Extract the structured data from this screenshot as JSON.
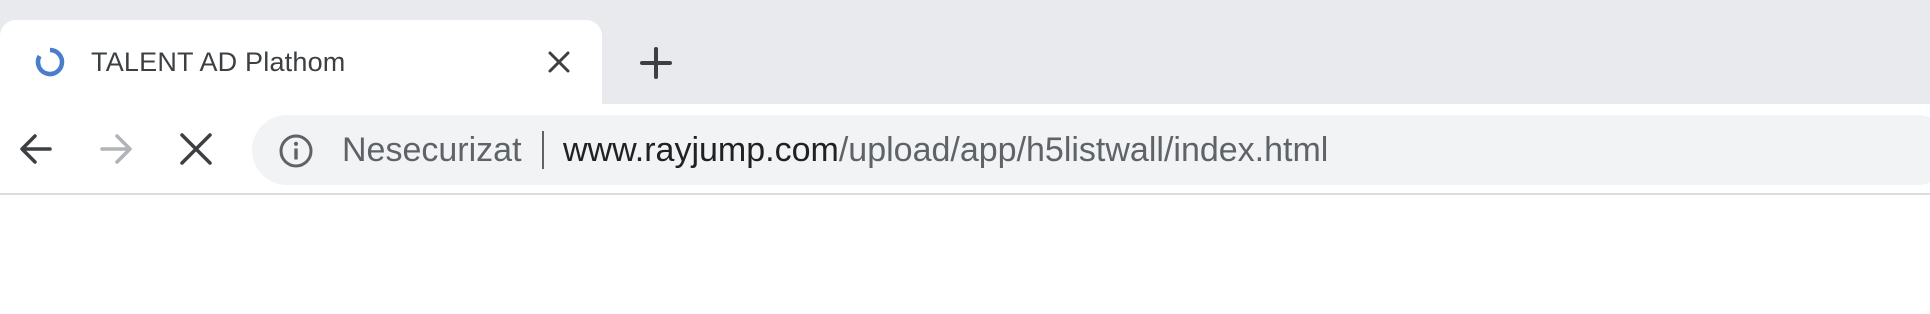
{
  "tab": {
    "title": "TALENT AD Plathom",
    "spinner_icon": "loading-spinner-icon",
    "close_icon": "close-icon"
  },
  "new_tab_icon": "plus-icon",
  "toolbar": {
    "back_icon": "arrow-left-icon",
    "forward_icon": "arrow-right-icon",
    "stop_icon": "close-icon"
  },
  "omnibox": {
    "security_icon": "info-icon",
    "security_label": "Nesecurizat",
    "url_host": "www.rayjump.com",
    "url_path": "/upload/app/h5listwall/index.html"
  },
  "colors": {
    "tabstrip_bg": "#e8eaed",
    "omnibox_bg": "#f1f3f4",
    "spinner": "#4a7ecb",
    "text_primary": "#202124",
    "text_secondary": "#5f6368"
  }
}
